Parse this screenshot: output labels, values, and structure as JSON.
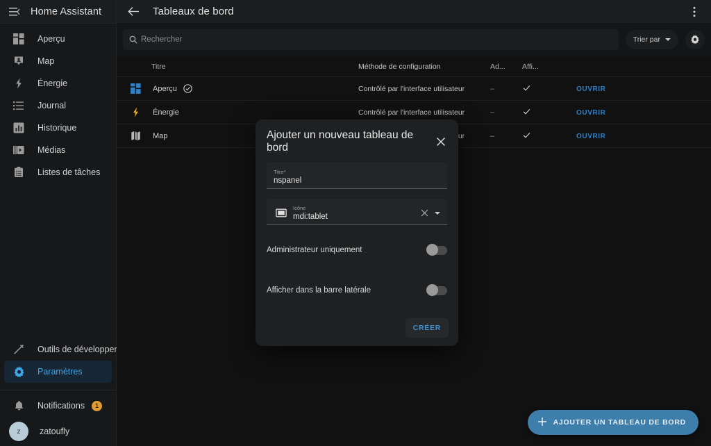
{
  "sidebar": {
    "burger_icon": "menu-collapse-icon",
    "title": "Home Assistant",
    "items": [
      {
        "label": "Aperçu",
        "icon": "view-dashboard-icon"
      },
      {
        "label": "Map",
        "icon": "map-marker-account-icon"
      },
      {
        "label": "Énergie",
        "icon": "lightning-bolt-icon"
      },
      {
        "label": "Journal",
        "icon": "format-list-bulleted-icon"
      },
      {
        "label": "Historique",
        "icon": "chart-box-icon"
      },
      {
        "label": "Médias",
        "icon": "play-box-multiple-icon"
      },
      {
        "label": "Listes de tâches",
        "icon": "clipboard-list-icon"
      }
    ],
    "lower_items": [
      {
        "label": "Outils de développement",
        "icon": "hammer-icon",
        "active": false
      },
      {
        "label": "Paramètres",
        "icon": "cog-icon",
        "active": true
      }
    ],
    "notifications": {
      "label": "Notifications",
      "icon": "bell-icon",
      "badge": "1"
    },
    "user": {
      "name": "zatoufly",
      "avatar_initial": "z"
    },
    "active_color": "#41a6e6",
    "badge_color": "#e09b33"
  },
  "topbar": {
    "back_icon": "arrow-left-icon",
    "title": "Tableaux de bord",
    "overflow_icon": "dots-vertical-icon"
  },
  "toolbar": {
    "search_placeholder": "Rechercher",
    "search_value": "",
    "search_icon": "search-icon",
    "sort_label": "Trier par",
    "sort_caret_icon": "chevron-down-icon",
    "settings_icon": "gear-icon"
  },
  "table": {
    "columns": {
      "title": "Titre",
      "method": "Méthode de configuration",
      "admin": "Ad...",
      "shown": "Affi..."
    },
    "rows": [
      {
        "icon": "view-dashboard-icon",
        "icon_color": "#2f7fc4",
        "title": "Aperçu",
        "default_badge_icon": "check-circle-outline-icon",
        "method": "Contrôlé par l'interface utilisateur",
        "admin": "–",
        "shown": "check-icon",
        "action": "OUVRIR"
      },
      {
        "icon": "lightning-bolt-icon",
        "icon_color": "#e0a020",
        "title": "Énergie",
        "default_badge_icon": "",
        "method": "Contrôlé par l'interface utilisateur",
        "admin": "–",
        "shown": "check-icon",
        "action": "OUVRIR"
      },
      {
        "icon": "map-icon",
        "icon_color": "#b9b9b9",
        "title": "Map",
        "default_badge_icon": "",
        "method": "Contrôlé par l'interface utilisateur",
        "admin": "–",
        "shown": "check-icon",
        "action": "OUVRIR"
      }
    ]
  },
  "fab": {
    "plus_icon": "plus-icon",
    "label": "AJOUTER UN TABLEAU DE BORD",
    "color": "#3d7eab"
  },
  "dialog": {
    "title": "Ajouter un nouveau tableau de bord",
    "close_icon": "close-icon",
    "title_field": {
      "label": "Titre*",
      "value": "nspanel"
    },
    "icon_field": {
      "label": "Icône",
      "value": "mdi:tablet",
      "leading_icon": "tablet-icon",
      "clear_icon": "close-icon",
      "caret_icon": "chevron-down-icon"
    },
    "toggles": [
      {
        "label": "Administrateur uniquement",
        "on": false
      },
      {
        "label": "Afficher dans la barre latérale",
        "on": false
      }
    ],
    "create_label": "CRÉER"
  }
}
